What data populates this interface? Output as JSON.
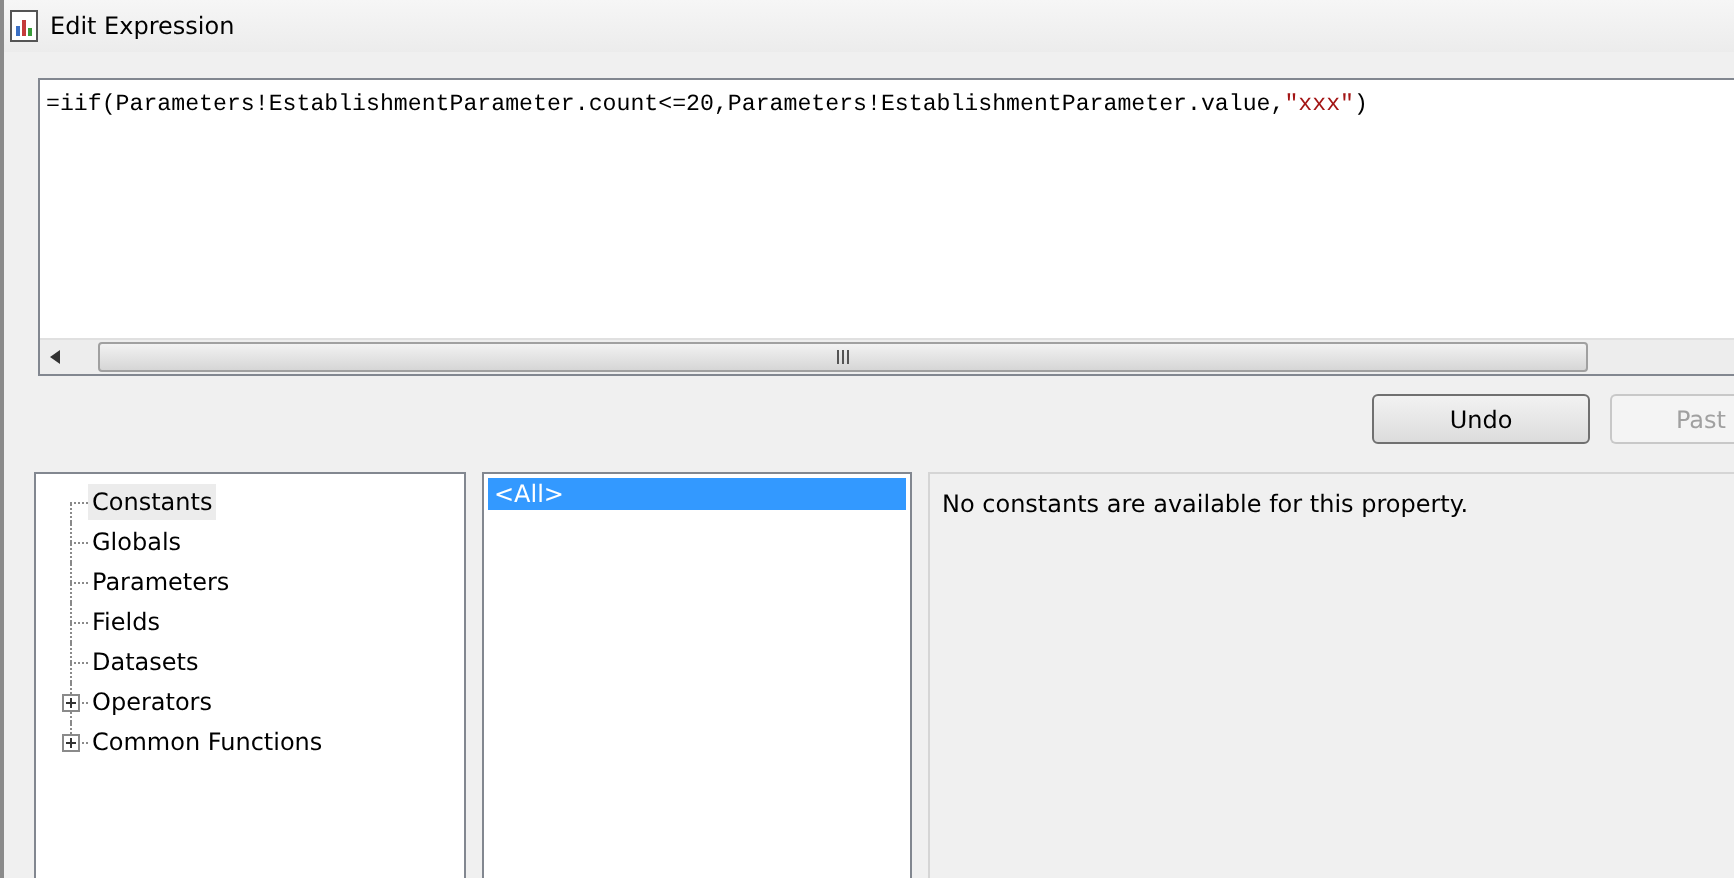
{
  "window": {
    "title": "Edit Expression"
  },
  "expression": [
    {
      "kind": "code",
      "text": "=iif(Parameters!EstablishmentParameter.count<=20,Parameters!EstablishmentParameter.value,"
    },
    {
      "kind": "string",
      "text": "\"xxx\""
    },
    {
      "kind": "code",
      "text": ")"
    }
  ],
  "buttons": [
    {
      "label": "Undo",
      "disabled": false
    },
    {
      "label": "Past",
      "disabled": true
    }
  ],
  "category_tree": [
    {
      "label": "Constants",
      "kind": "leaf",
      "selected": true
    },
    {
      "label": "Globals",
      "kind": "leaf",
      "selected": false
    },
    {
      "label": "Parameters",
      "kind": "leaf",
      "selected": false
    },
    {
      "label": "Fields",
      "kind": "leaf",
      "selected": false
    },
    {
      "label": "Datasets",
      "kind": "leaf",
      "selected": false
    },
    {
      "label": "Operators",
      "kind": "group",
      "expanded": false,
      "selected": false
    },
    {
      "label": "Common Functions",
      "kind": "group",
      "expanded": false,
      "selected": false
    }
  ],
  "item_list": [
    {
      "label": "<All>",
      "selected": true
    }
  ],
  "description": "No constants are available for this property."
}
